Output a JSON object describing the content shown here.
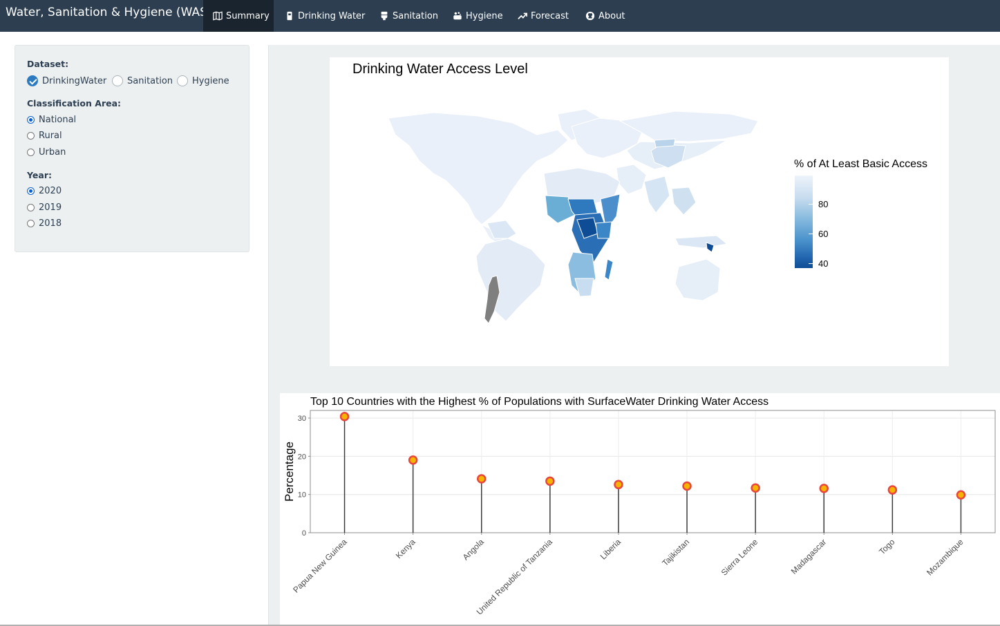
{
  "navbar": {
    "brand": "Water, Sanitation & Hygiene (WASH)",
    "tabs": [
      {
        "label": "Summary",
        "icon": "map-icon",
        "active": true
      },
      {
        "label": "Drinking Water",
        "icon": "bottle-icon",
        "active": false
      },
      {
        "label": "Sanitation",
        "icon": "toilet-icon",
        "active": false
      },
      {
        "label": "Hygiene",
        "icon": "soap-icon",
        "active": false
      },
      {
        "label": "Forecast",
        "icon": "trend-icon",
        "active": false
      },
      {
        "label": "About",
        "icon": "github-icon",
        "active": false
      }
    ]
  },
  "sidebar": {
    "dataset": {
      "label": "Dataset:",
      "options": [
        "DrinkingWater",
        "Sanitation",
        "Hygiene"
      ],
      "selected": "DrinkingWater"
    },
    "area": {
      "label": "Classification Area:",
      "options": [
        "National",
        "Rural",
        "Urban"
      ],
      "selected": "National"
    },
    "year": {
      "label": "Year:",
      "options": [
        "2020",
        "2019",
        "2018"
      ],
      "selected": "2020"
    }
  },
  "map": {
    "title": "Drinking Water Access Level",
    "legend_title": "% of At Least Basic Access",
    "legend_ticks": [
      "80",
      "60",
      "40"
    ],
    "colors": {
      "high": "#eef3fb",
      "mid": "#6baed6",
      "low": "#0e4c95",
      "missing": "#7f7f7f"
    }
  },
  "chart_data": {
    "type": "lollipop",
    "title": "Top 10 Countries with the Highest % of Populations with SurfaceWater Drinking Water Access",
    "xlabel": "",
    "ylabel": "Percentage",
    "ylim": [
      0,
      32
    ],
    "yticks": [
      0,
      10,
      20,
      30
    ],
    "grid": true,
    "categories": [
      "Papua New Guinea",
      "Kenya",
      "Angola",
      "United Republic of Tanzania",
      "Liberia",
      "Tajikistan",
      "Sierra Leone",
      "Madagascar",
      "Togo",
      "Mozambique"
    ],
    "values": [
      30.4,
      19.0,
      14.1,
      13.5,
      12.6,
      12.2,
      11.7,
      11.6,
      11.2,
      9.9
    ],
    "colors": {
      "point_fill": "#f5b400",
      "point_stroke": "#e8453c",
      "stem": "#3a3a3a"
    }
  }
}
